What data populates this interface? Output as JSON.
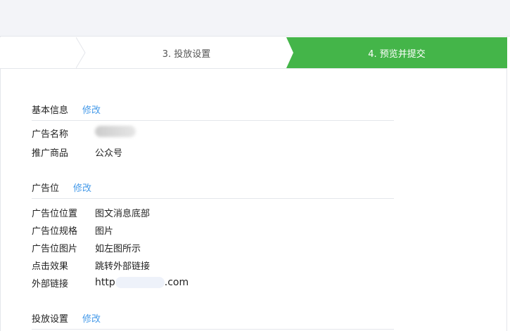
{
  "steps": [
    {
      "label": "3. 投放设置"
    },
    {
      "label": "4. 预览并提交",
      "active": true
    }
  ],
  "accent": "#44b549",
  "link_color": "#459ae9",
  "sections": [
    {
      "title": "基本信息",
      "edit": "修改",
      "rows": [
        {
          "k": "广告名称",
          "v": ""
        },
        {
          "k": "推广商品",
          "v": "公众号"
        }
      ]
    },
    {
      "title": "广告位",
      "edit": "修改",
      "rows": [
        {
          "k": "广告位位置",
          "v": "图文消息底部"
        },
        {
          "k": "广告位规格",
          "v": "图片"
        },
        {
          "k": "广告位图片",
          "v": "如左图所示"
        },
        {
          "k": "点击效果",
          "v": "跳转外部链接"
        },
        {
          "k": "外部链接",
          "v_prefix": "http",
          "v_suffix": ".com"
        }
      ]
    },
    {
      "title": "投放设置",
      "edit": "修改"
    }
  ]
}
